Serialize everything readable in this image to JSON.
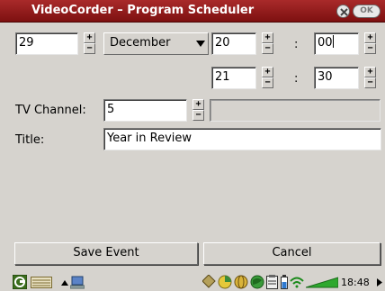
{
  "window": {
    "title": "VideoCorder – Program Scheduler",
    "ok_label": "OK"
  },
  "date": {
    "day": "29",
    "month": "December"
  },
  "start_time": {
    "hour": "20",
    "minute": "00"
  },
  "end_time": {
    "hour": "21",
    "minute": "30"
  },
  "time_separator": ":",
  "channel": {
    "label": "TV Channel:",
    "value": "5",
    "name": ""
  },
  "title_field": {
    "label": "Title:",
    "value": "Year in Review"
  },
  "buttons": {
    "save": "Save Event",
    "cancel": "Cancel"
  },
  "taskbar": {
    "clock": "18:48",
    "icons": [
      "app-launcher-icon",
      "keyboard-icon",
      "arrow-up-icon",
      "computer-icon",
      "tools-icon",
      "pie-icon",
      "globe-icon",
      "globe-network-icon",
      "clipboard-icon",
      "battery-icon",
      "wifi-icon",
      "volume-icon",
      "arrow-right-icon"
    ]
  },
  "colors": {
    "titlebar": "#951e1e",
    "background": "#d6d3ce"
  }
}
